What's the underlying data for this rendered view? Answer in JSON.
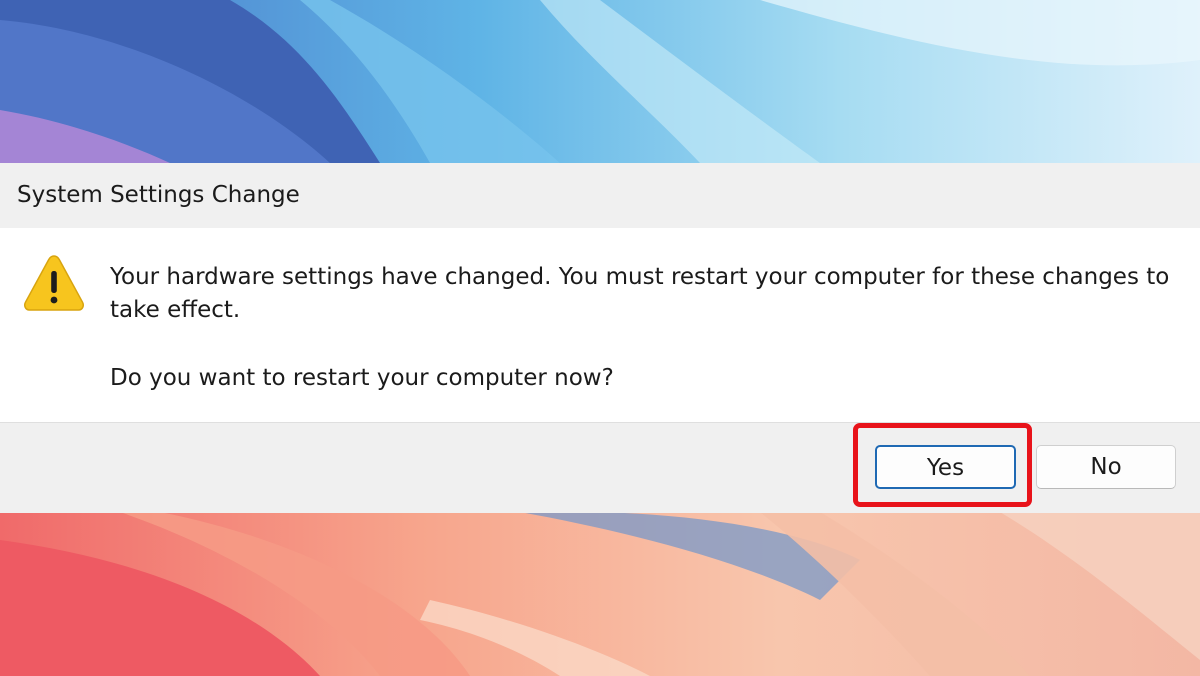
{
  "dialog": {
    "title": "System Settings Change",
    "message": "Your hardware settings have changed. You must restart your computer for these changes to take effect.",
    "question": "Do you want to restart your computer now?",
    "icon": "warning-icon",
    "buttons": {
      "yes_label": "Yes",
      "no_label": "No"
    }
  },
  "annotation": {
    "highlight_color": "#e8131a",
    "highlighted_element": "yes-button"
  },
  "colors": {
    "titlebar_bg": "#f0f0f0",
    "content_bg": "#ffffff",
    "footer_bg": "#f0f0f0",
    "default_button_border": "#1f69b3",
    "warning_yellow": "#f7c51e"
  }
}
